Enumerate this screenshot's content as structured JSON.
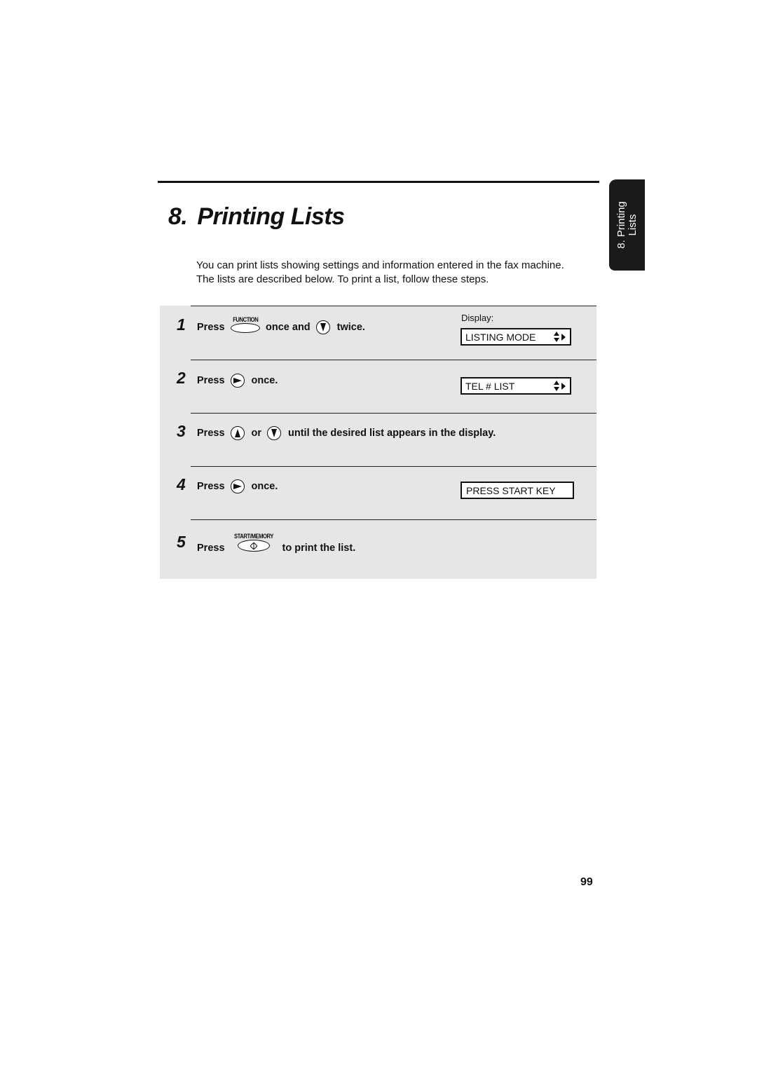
{
  "chapter": {
    "number": "8.",
    "title": "Printing Lists",
    "side_tab": {
      "line1": "8. Printing",
      "line2": "Lists"
    }
  },
  "intro": "You can print lists showing settings and information entered in the fax machine. The lists are described below. To print a list, follow these steps.",
  "display_label": "Display:",
  "steps": [
    {
      "number": "1",
      "press": "Press",
      "key1_label": "FUNCTION",
      "middle": "once and",
      "key2_icon": "down-arrow-key",
      "end": "twice.",
      "display": "LISTING MODE"
    },
    {
      "number": "2",
      "press": "Press",
      "key_icon": "right-arrow-key",
      "end": "once.",
      "display": "TEL # LIST"
    },
    {
      "number": "3",
      "press": "Press",
      "key1_icon": "up-arrow-key",
      "middle": "or",
      "key2_icon": "down-arrow-key",
      "end": "until the desired list appears in the display."
    },
    {
      "number": "4",
      "press": "Press",
      "key_icon": "right-arrow-key",
      "end": "once.",
      "display": "PRESS START KEY"
    },
    {
      "number": "5",
      "press": "Press",
      "key_label": "START/MEMORY",
      "end": "to print the list."
    }
  ],
  "page_number": "99"
}
